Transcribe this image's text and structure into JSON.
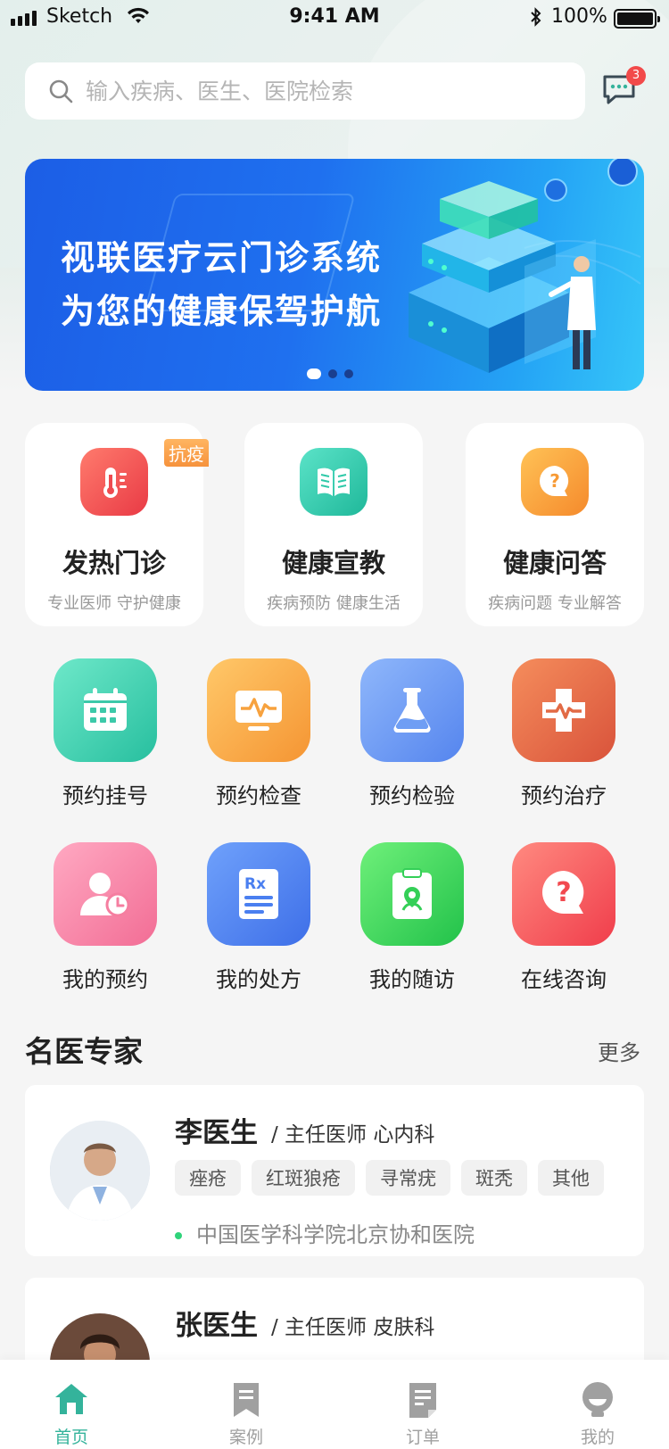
{
  "status_bar": {
    "carrier": "Sketch",
    "time": "9:41 AM",
    "battery": "100%"
  },
  "search": {
    "placeholder": "输入疾病、医生、医院检索"
  },
  "messages": {
    "badge": "3"
  },
  "banner": {
    "line1": "视联医疗云门诊系统",
    "line2": "为您的健康保驾护航",
    "slide_count": 3,
    "active_slide": 1
  },
  "feature_cards": [
    {
      "title": "发热门诊",
      "subtitle": "专业医师 守护健康",
      "tag": "抗疫",
      "icon": "thermometer-icon",
      "color": "#f1504e"
    },
    {
      "title": "健康宣教",
      "subtitle": "疾病预防 健康生活",
      "icon": "book-icon",
      "color": "#2ec9a8"
    },
    {
      "title": "健康问答",
      "subtitle": "疾病问题 专业解答",
      "icon": "question-bubble-icon",
      "color": "#f9a23b"
    }
  ],
  "services": [
    {
      "label": "预约挂号",
      "icon": "calendar-icon",
      "color": "#4fd3b3"
    },
    {
      "label": "预约检查",
      "icon": "monitor-pulse-icon",
      "color": "#f9a63b"
    },
    {
      "label": "预约检验",
      "icon": "flask-icon",
      "color": "#6e9cf5"
    },
    {
      "label": "预约治疗",
      "icon": "medical-cross-icon",
      "color": "#e8714c"
    },
    {
      "label": "我的预约",
      "icon": "user-clock-icon",
      "color": "#f67ea0"
    },
    {
      "label": "我的处方",
      "icon": "prescription-icon",
      "color": "#4c84f2"
    },
    {
      "label": "我的随访",
      "icon": "clipboard-user-icon",
      "color": "#3ed45e"
    },
    {
      "label": "在线咨询",
      "icon": "question-chat-icon",
      "color": "#f5545a"
    }
  ],
  "experts": {
    "title": "名医专家",
    "more": "更多",
    "doctors": [
      {
        "name": "李医生",
        "role": "/ 主任医师   心内科",
        "tags": [
          "痤疮",
          "红斑狼疮",
          "寻常疣",
          "斑秃",
          "其他"
        ],
        "hospital": "中国医学科学院北京协和医院"
      },
      {
        "name": "张医生",
        "role": "/ 主任医师   皮肤科"
      }
    ]
  },
  "tabbar": {
    "items": [
      {
        "label": "首页",
        "icon": "home-icon",
        "active": true
      },
      {
        "label": "案例",
        "icon": "bookmark-icon"
      },
      {
        "label": "订单",
        "icon": "order-icon"
      },
      {
        "label": "我的",
        "icon": "profile-icon"
      }
    ],
    "active_color": "#34b39b",
    "inactive_color": "#a0a0a0"
  }
}
